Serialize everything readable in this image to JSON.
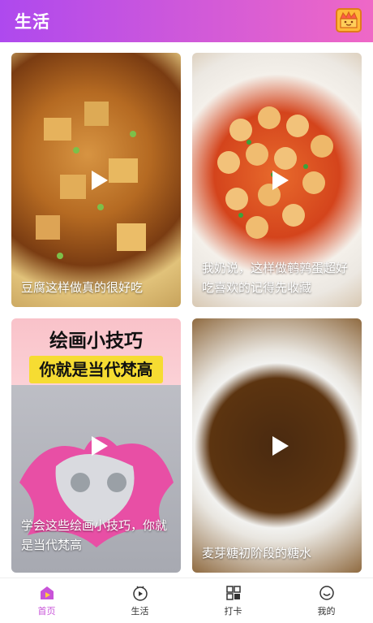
{
  "header": {
    "title": "生活",
    "crown_icon": "crown-icon"
  },
  "feed": {
    "items": [
      {
        "caption": "豆腐这样做真的很好吃",
        "play_icon": "play-icon"
      },
      {
        "caption": "我奶说，这样做鹌鹑蛋超好吃喜欢的记得先收藏",
        "play_icon": "play-icon"
      },
      {
        "overlay_title": "绘画小技巧",
        "overlay_subtitle": "你就是当代梵高",
        "caption": "学会这些绘画小技巧，你就是当代梵高",
        "play_icon": "play-icon"
      },
      {
        "caption": "麦芽糖初阶段的糖水",
        "play_icon": "play-icon"
      }
    ]
  },
  "tabbar": {
    "accent_color": "#c853d8",
    "tabs": [
      {
        "label": "首页",
        "icon": "home-play-icon",
        "active": true
      },
      {
        "label": "生活",
        "icon": "tv-icon",
        "active": false
      },
      {
        "label": "打卡",
        "icon": "grid-icon",
        "active": false
      },
      {
        "label": "我的",
        "icon": "smile-icon",
        "active": false
      }
    ]
  }
}
